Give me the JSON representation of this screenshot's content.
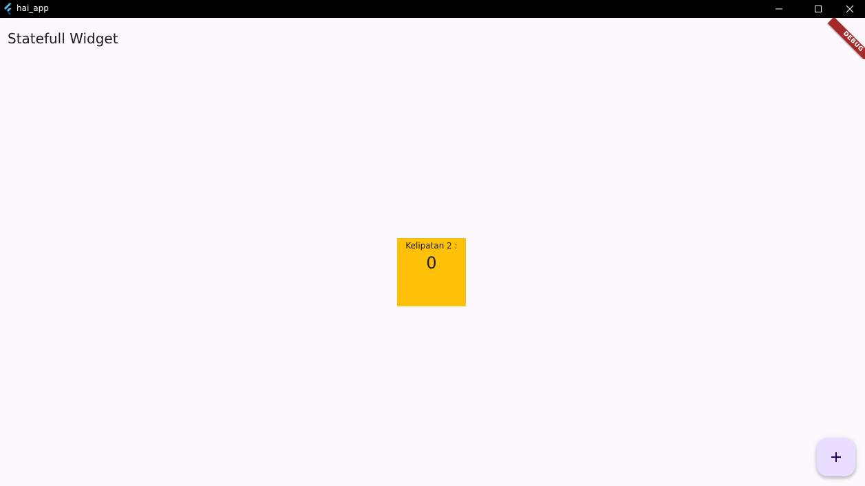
{
  "window": {
    "title": "hai_app",
    "controls": {
      "minimize_icon": "minimize-icon",
      "maximize_icon": "maximize-icon",
      "close_icon": "close-icon"
    }
  },
  "appbar": {
    "title": "Statefull Widget"
  },
  "debug_banner": {
    "label": "DEBUG",
    "color": "#a52a2a"
  },
  "counter": {
    "label": "Kelipatan 2 :",
    "value": "0",
    "background": "#ffc107"
  },
  "fab": {
    "icon": "add-icon",
    "background": "#eaddff"
  },
  "colors": {
    "page_background": "#fdf7fe",
    "text": "#1d1b20"
  }
}
